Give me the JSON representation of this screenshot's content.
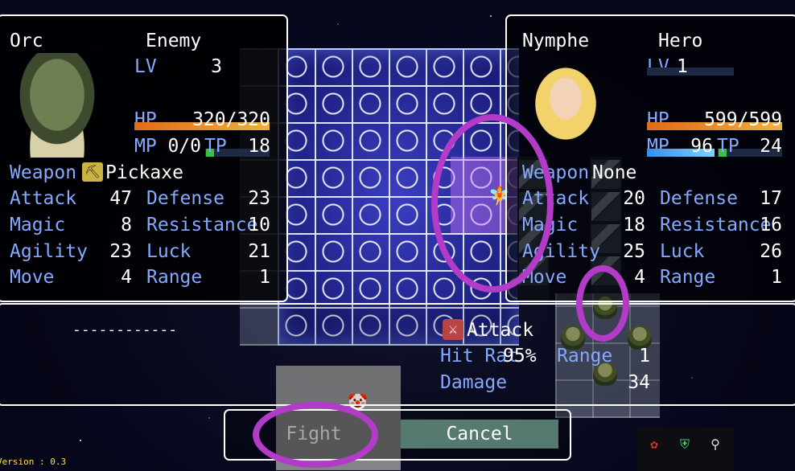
{
  "enemy": {
    "name": "Orc",
    "side_label": "Enemy",
    "lv_label": "LV",
    "lv": "3",
    "hp_label": "HP",
    "hp": "320/320",
    "mp_label": "MP",
    "mp": "0/0",
    "tp_label": "TP",
    "tp": "18",
    "weapon_label": "Weapon",
    "weapon": "Pickaxe",
    "stats": [
      {
        "label": "Attack",
        "value": "47"
      },
      {
        "label": "Magic",
        "value": "8"
      },
      {
        "label": "Agility",
        "value": "23"
      },
      {
        "label": "Move",
        "value": "4"
      }
    ],
    "stats2": [
      {
        "label": "Defense",
        "value": "23"
      },
      {
        "label": "Resistance",
        "value": "10"
      },
      {
        "label": "Luck",
        "value": "21"
      },
      {
        "label": "Range",
        "value": "1"
      }
    ],
    "hp_fill": 1.0,
    "colors": {
      "hp": "#e0752a",
      "mp": "#2f7fe0"
    }
  },
  "hero": {
    "name": "Nymphe",
    "side_label": "Hero",
    "lv_label": "LV",
    "lv": "1",
    "hp_label": "HP",
    "hp": "599/599",
    "mp_label": "MP",
    "mp": "96",
    "tp_label": "TP",
    "tp": "24",
    "weapon_label": "Weapon",
    "weapon": "None",
    "stats": [
      {
        "label": "Attack",
        "value": "20"
      },
      {
        "label": "Magic",
        "value": "18"
      },
      {
        "label": "Agility",
        "value": "25"
      },
      {
        "label": "Move",
        "value": "4"
      }
    ],
    "stats2": [
      {
        "label": "Defense",
        "value": "17"
      },
      {
        "label": "Resistance",
        "value": "16"
      },
      {
        "label": "Luck",
        "value": "26"
      },
      {
        "label": "Range",
        "value": "1"
      }
    ],
    "hp_fill": 1.0
  },
  "forecast": {
    "enemy_action": "------------",
    "action_label": "Attack",
    "hit_label": "Hit Rat",
    "hit_value": "95%",
    "range_label": "Range",
    "range_value": "1",
    "damage_label": "Damage",
    "damage_value": "34"
  },
  "commands": {
    "fight": "Fight",
    "cancel": "Cancel"
  },
  "version": "Version : 0.3",
  "tray_icons": [
    "berries-icon",
    "shield-icon",
    "satellite-icon"
  ]
}
